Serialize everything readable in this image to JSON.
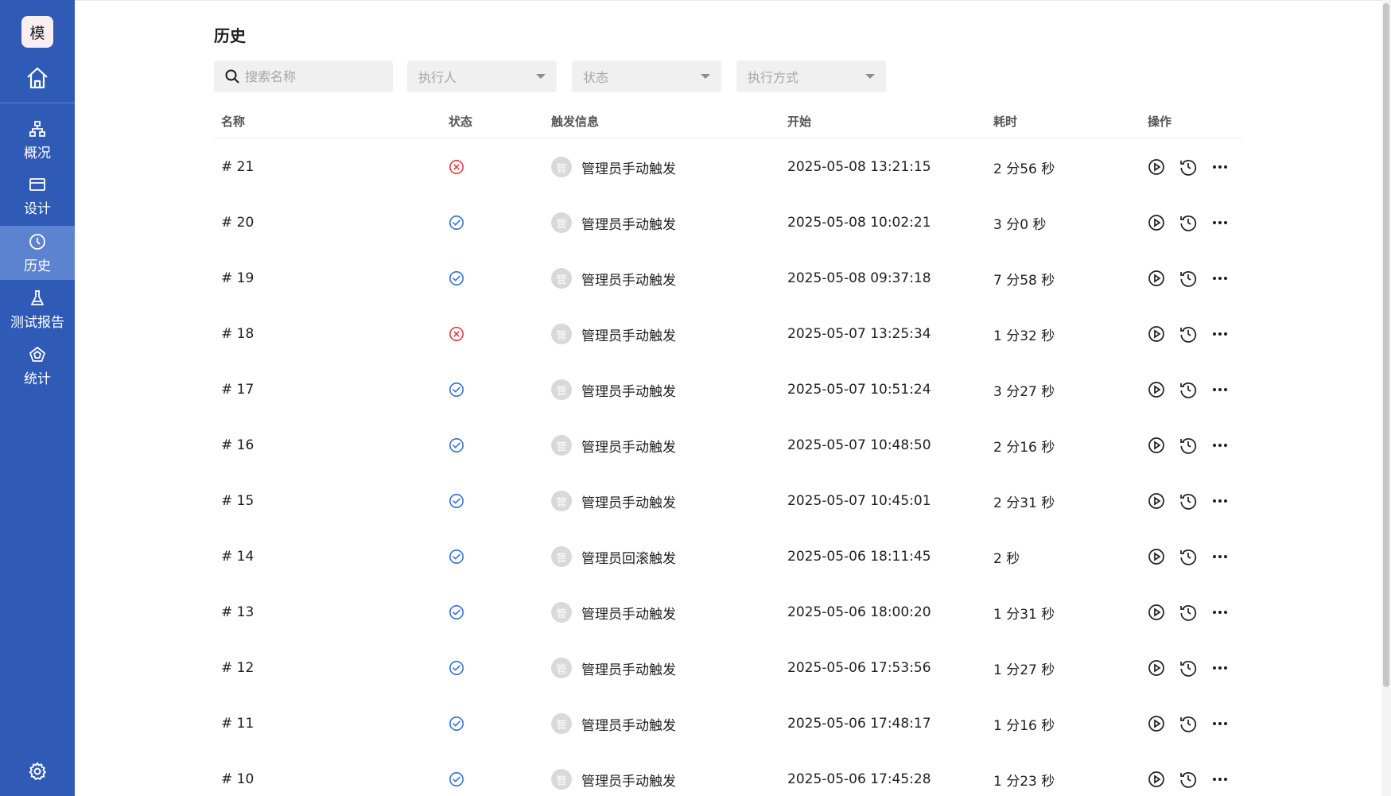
{
  "sidebar": {
    "logo_text": "模",
    "items": [
      {
        "label": "概况",
        "icon": "org-chart-icon",
        "active": false
      },
      {
        "label": "设计",
        "icon": "card-icon",
        "active": false
      },
      {
        "label": "历史",
        "icon": "clock-icon",
        "active": true
      },
      {
        "label": "测试报告",
        "icon": "flask-icon",
        "active": false
      },
      {
        "label": "统计",
        "icon": "pentagon-chart-icon",
        "active": false
      }
    ]
  },
  "page": {
    "title": "历史"
  },
  "filters": {
    "search_placeholder": "搜索名称",
    "executor": "执行人",
    "status": "状态",
    "method": "执行方式"
  },
  "table": {
    "headers": {
      "name": "名称",
      "status": "状态",
      "trigger": "触发信息",
      "start": "开始",
      "duration": "耗时",
      "actions": "操作"
    },
    "rows": [
      {
        "name": "# 21",
        "status": "failed",
        "avatar": "管",
        "trigger": "管理员手动触发",
        "start": "2025-05-08 13:21:15",
        "duration": "2 分56 秒"
      },
      {
        "name": "# 20",
        "status": "success",
        "avatar": "管",
        "trigger": "管理员手动触发",
        "start": "2025-05-08 10:02:21",
        "duration": "3 分0 秒"
      },
      {
        "name": "# 19",
        "status": "success",
        "avatar": "管",
        "trigger": "管理员手动触发",
        "start": "2025-05-08 09:37:18",
        "duration": "7 分58 秒"
      },
      {
        "name": "# 18",
        "status": "failed",
        "avatar": "管",
        "trigger": "管理员手动触发",
        "start": "2025-05-07 13:25:34",
        "duration": "1 分32 秒"
      },
      {
        "name": "# 17",
        "status": "success",
        "avatar": "管",
        "trigger": "管理员手动触发",
        "start": "2025-05-07 10:51:24",
        "duration": "3 分27 秒"
      },
      {
        "name": "# 16",
        "status": "success",
        "avatar": "管",
        "trigger": "管理员手动触发",
        "start": "2025-05-07 10:48:50",
        "duration": "2 分16 秒"
      },
      {
        "name": "# 15",
        "status": "success",
        "avatar": "管",
        "trigger": "管理员手动触发",
        "start": "2025-05-07 10:45:01",
        "duration": "2 分31 秒"
      },
      {
        "name": "# 14",
        "status": "success",
        "avatar": "管",
        "trigger": "管理员回滚触发",
        "start": "2025-05-06 18:11:45",
        "duration": "2 秒"
      },
      {
        "name": "# 13",
        "status": "success",
        "avatar": "管",
        "trigger": "管理员手动触发",
        "start": "2025-05-06 18:00:20",
        "duration": "1 分31 秒"
      },
      {
        "name": "# 12",
        "status": "success",
        "avatar": "管",
        "trigger": "管理员手动触发",
        "start": "2025-05-06 17:53:56",
        "duration": "1 分27 秒"
      },
      {
        "name": "# 11",
        "status": "success",
        "avatar": "管",
        "trigger": "管理员手动触发",
        "start": "2025-05-06 17:48:17",
        "duration": "1 分16 秒"
      },
      {
        "name": "# 10",
        "status": "success",
        "avatar": "管",
        "trigger": "管理员手动触发",
        "start": "2025-05-06 17:45:28",
        "duration": "1 分23 秒"
      }
    ]
  },
  "colors": {
    "sidebar_bg": "#2f5bb7",
    "sidebar_active": "#5b83cf",
    "status_success": "#2f6fd6",
    "status_failed": "#e23b3b"
  }
}
